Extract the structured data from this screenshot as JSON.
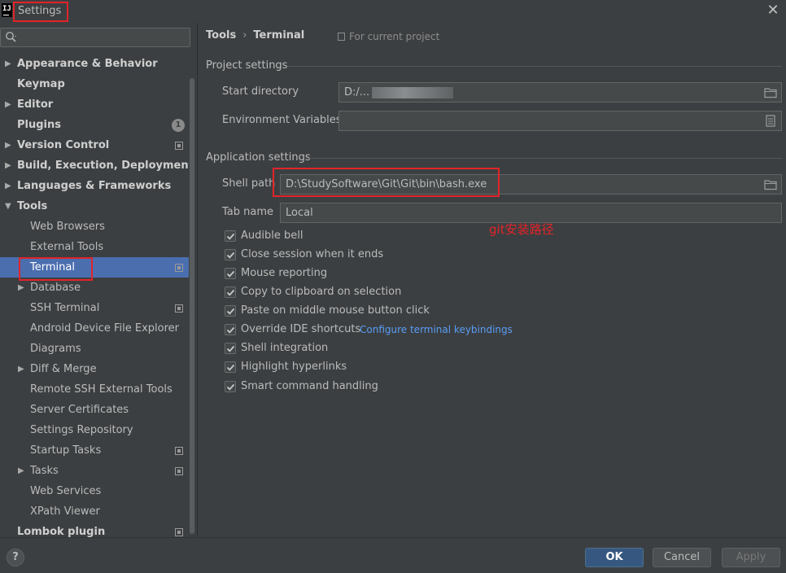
{
  "window": {
    "title": "Settings",
    "app_icon_text": "IJ",
    "close_glyph": "✕"
  },
  "sidebar": {
    "search_placeholder": "",
    "items": [
      {
        "label": "Appearance & Behavior",
        "level": "top",
        "arrow": "▶"
      },
      {
        "label": "Keymap",
        "level": "top"
      },
      {
        "label": "Editor",
        "level": "top",
        "arrow": "▶"
      },
      {
        "label": "Plugins",
        "level": "top",
        "badge": "1"
      },
      {
        "label": "Version Control",
        "level": "top",
        "arrow": "▶",
        "project_icon": true
      },
      {
        "label": "Build, Execution, Deployment",
        "level": "top",
        "arrow": "▶"
      },
      {
        "label": "Languages & Frameworks",
        "level": "top",
        "arrow": "▶"
      },
      {
        "label": "Tools",
        "level": "top",
        "arrow": "▼"
      },
      {
        "label": "Web Browsers",
        "level": "sub"
      },
      {
        "label": "External Tools",
        "level": "sub"
      },
      {
        "label": "Terminal",
        "level": "sub",
        "selected": true,
        "project_icon": true
      },
      {
        "label": "Database",
        "level": "sub",
        "arrow": "▶"
      },
      {
        "label": "SSH Terminal",
        "level": "sub",
        "project_icon": true
      },
      {
        "label": "Android Device File Explorer",
        "level": "sub"
      },
      {
        "label": "Diagrams",
        "level": "sub"
      },
      {
        "label": "Diff & Merge",
        "level": "sub",
        "arrow": "▶"
      },
      {
        "label": "Remote SSH External Tools",
        "level": "sub"
      },
      {
        "label": "Server Certificates",
        "level": "sub"
      },
      {
        "label": "Settings Repository",
        "level": "sub"
      },
      {
        "label": "Startup Tasks",
        "level": "sub",
        "project_icon": true
      },
      {
        "label": "Tasks",
        "level": "sub",
        "arrow": "▶",
        "project_icon": true
      },
      {
        "label": "Web Services",
        "level": "sub"
      },
      {
        "label": "XPath Viewer",
        "level": "sub"
      },
      {
        "label": "Lombok plugin",
        "level": "top",
        "project_icon": true
      }
    ]
  },
  "main": {
    "breadcrumb": {
      "parent": "Tools",
      "separator": "›",
      "current": "Terminal"
    },
    "scope_label": "For current project",
    "project_settings": {
      "title": "Project settings",
      "start_directory_label": "Start directory",
      "start_directory_value": "D:/...",
      "env_vars_label": "Environment Variables",
      "env_vars_value": ""
    },
    "application_settings": {
      "title": "Application settings",
      "shell_path_label": "Shell path",
      "shell_path_value": "D:\\StudySoftware\\Git\\Git\\bin\\bash.exe",
      "tab_name_label": "Tab name",
      "tab_name_value": "Local"
    },
    "annotation": "git安装路径",
    "checkboxes": [
      {
        "label": "Audible bell",
        "checked": true
      },
      {
        "label": "Close session when it ends",
        "checked": true
      },
      {
        "label": "Mouse reporting",
        "checked": true
      },
      {
        "label": "Copy to clipboard on selection",
        "checked": true
      },
      {
        "label": "Paste on middle mouse button click",
        "checked": true
      },
      {
        "label": "Override IDE shortcuts",
        "checked": true
      },
      {
        "label": "Shell integration",
        "checked": true
      },
      {
        "label": "Highlight hyperlinks",
        "checked": true
      },
      {
        "label": "Smart command handling",
        "checked": true
      }
    ],
    "keybindings_link": "Configure terminal keybindings"
  },
  "footer": {
    "help": "?",
    "ok": "OK",
    "cancel": "Cancel",
    "apply": "Apply"
  },
  "colors": {
    "background": "#3c3f41",
    "selection": "#4b6eaf",
    "annotation_red": "#e1242a",
    "link_blue": "#589df6",
    "primary_button": "#365880"
  }
}
